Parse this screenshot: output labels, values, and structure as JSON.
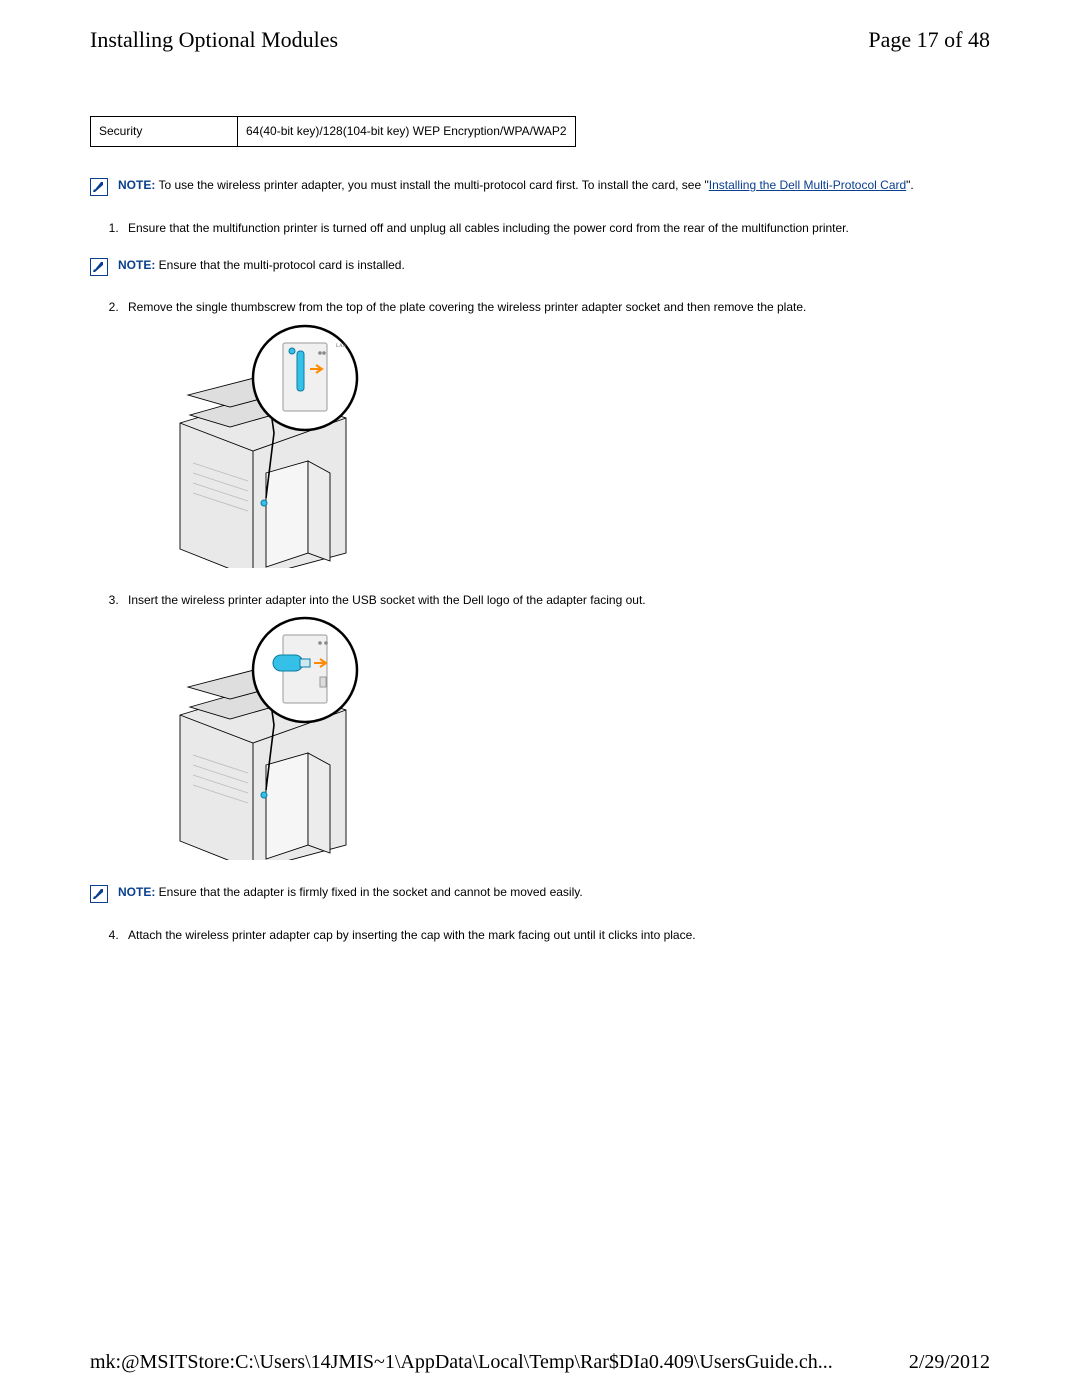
{
  "header": {
    "title": "Installing Optional Modules",
    "page_indicator": "Page 17 of 48"
  },
  "table": {
    "header": "Security",
    "value": "64(40-bit key)/128(104-bit key) WEP Encryption/WPA/WAP2"
  },
  "notes": {
    "label": "NOTE:",
    "note1_pre": " To use the wireless printer adapter, you must install the multi-protocol card first. To install the card, see \"",
    "note1_link": "Installing the Dell Multi-Protocol Card",
    "note1_post": "\".",
    "note2_body": " Ensure that the multi-protocol card is installed.",
    "note3_body": " Ensure that the adapter is firmly fixed in the socket and cannot be moved easily."
  },
  "steps": {
    "s1": "Ensure that the multifunction printer is turned off and unplug all cables including the power cord from the rear of the multifunction printer.",
    "s2": "Remove the single thumbscrew from the top of the plate covering the wireless printer adapter socket and then remove the plate.",
    "s3": "Insert the wireless printer adapter into the USB socket with the Dell logo of the adapter facing out.",
    "s4": "Attach the wireless printer adapter cap by inserting the cap with the mark facing out until it clicks into place."
  },
  "footer": {
    "path": "mk:@MSITStore:C:\\Users\\14JMIS~1\\AppData\\Local\\Temp\\Rar$DIa0.409\\UsersGuide.ch...",
    "date": "2/29/2012"
  }
}
